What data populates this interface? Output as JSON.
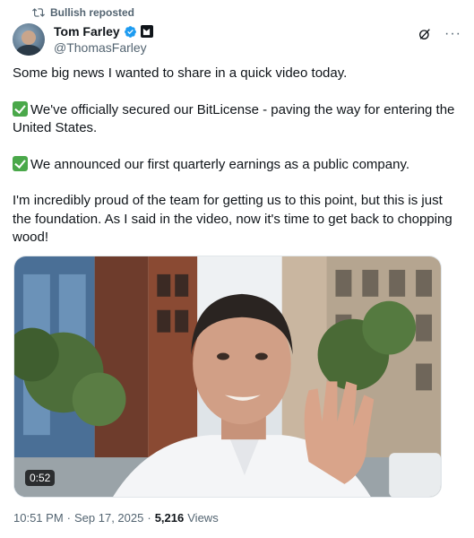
{
  "repost": {
    "label": "Bullish reposted",
    "icon": "repost-icon"
  },
  "author": {
    "display_name": "Tom Farley",
    "handle": "@ThomasFarley",
    "verified_color": "#1d9bf0",
    "avatar_icon": "avatar"
  },
  "actions": {
    "grok": "grok-icon",
    "more": "···"
  },
  "tweet": {
    "line1": "Some big news I wanted to share in a quick video today.",
    "line2": "We've officially secured our BitLicense - paving the way for entering the United States.",
    "line3": "We announced our first quarterly earnings as a public company.",
    "line4": "I'm incredibly proud of the team for getting us to this point, but this is just the foundation. As I said in the video, now it's time to get back to chopping wood!"
  },
  "media": {
    "duration": "0:52"
  },
  "meta": {
    "time": "10:51 PM",
    "date": "Sep 17, 2025",
    "sep": "·",
    "views_count": "5,216",
    "views_label": "Views"
  },
  "colors": {
    "accent": "#1d9bf0",
    "muted": "#536471",
    "check": "#4aa84a"
  }
}
